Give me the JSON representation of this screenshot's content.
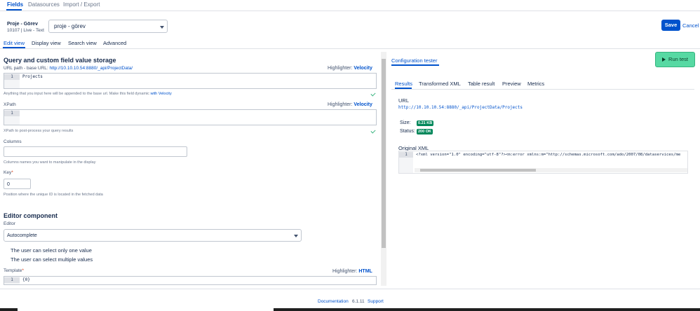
{
  "topnav": {
    "tabs": [
      {
        "label": "Fields"
      },
      {
        "label": "Datasources"
      },
      {
        "label": "Import / Export"
      }
    ]
  },
  "field": {
    "name": "Proje - Görev",
    "meta": "10107 | Live - Text",
    "selected": "proje - görev"
  },
  "actions": {
    "save": "Save",
    "cancel": "Cancel"
  },
  "subtabs": [
    {
      "label": "Edit view"
    },
    {
      "label": "Display view"
    },
    {
      "label": "Search view"
    },
    {
      "label": "Advanced"
    }
  ],
  "query": {
    "title": "Query and custom field value storage",
    "url_label": "URL path - base URL:",
    "base_url": "http://10.10.10.54:8880/_api/ProjectData/",
    "highlighter_label": "Highlighter:",
    "highlighter_value": "Velocity",
    "url_line_no": "1",
    "url_value": "Projects",
    "url_hint": "Anything that you input here will be appended to the base url. Make this field dynamic",
    "url_hint_link": "with Velocity",
    "xpath_label": "XPath",
    "xpath_line_no": "1",
    "xpath_hint": "XPath to post-process your query results",
    "columns_label": "Columns",
    "columns_value": "",
    "columns_hint": "Columns names you want to manipulate in the display",
    "key_label": "Key",
    "key_required": "*",
    "key_value": "0",
    "key_hint": "Position where the unique ID is located in the fetched data"
  },
  "editor": {
    "title": "Editor component",
    "editor_label": "Editor",
    "editor_value": "Autocomplete",
    "option_single": "The user can select only one value",
    "option_multiple": "The user can select multiple values",
    "template_label": "Template",
    "template_required": "*",
    "template_highlighter_label": "Highlighter:",
    "template_highlighter_value": "HTML",
    "template_line_no": "1",
    "template_value": "{0}"
  },
  "tester": {
    "tab": "Configuration tester",
    "run": "Run test",
    "result_tabs": [
      {
        "label": "Results"
      },
      {
        "label": "Transformed XML"
      },
      {
        "label": "Table result"
      },
      {
        "label": "Preview"
      },
      {
        "label": "Metrics"
      }
    ],
    "url_label": "URL",
    "url": "http://10.10.10.54:8880/_api/ProjectData/Projects",
    "size_label": "Size:",
    "size_value": "0.21 KB",
    "status_label": "Status:",
    "status_value": "200 OK",
    "xml_label": "Original XML",
    "xml_line_no": "1",
    "xml_value": "<?xml version=\"1.0\" encoding=\"utf-8\"?><m:error xmlns:m=\"http://schemas.microsoft.com/ado/2007/08/dataservices/me"
  },
  "footer": {
    "documentation": "Documentation",
    "version": "6.1.11",
    "support": "Support"
  },
  "colors": {
    "accent": "#0052cc",
    "run": "#57d9a3",
    "success": "#00875a"
  }
}
